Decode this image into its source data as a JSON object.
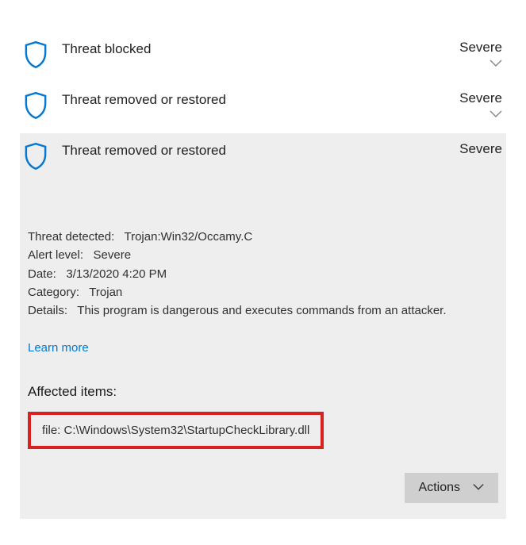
{
  "threats": [
    {
      "title": "Threat blocked",
      "severity": "Severe",
      "expanded": false
    },
    {
      "title": "Threat removed or restored",
      "severity": "Severe",
      "expanded": false
    },
    {
      "title": "Threat removed or restored",
      "severity": "Severe",
      "expanded": true,
      "details": {
        "threat_detected_label": "Threat detected:",
        "threat_detected_value": "Trojan:Win32/Occamy.C",
        "alert_level_label": "Alert level:",
        "alert_level_value": "Severe",
        "date_label": "Date:",
        "date_value": "3/13/2020 4:20 PM",
        "category_label": "Category:",
        "category_value": "Trojan",
        "details_label": "Details:",
        "details_value": "This program is dangerous and executes commands from an attacker."
      },
      "learn_more": "Learn more",
      "affected_heading": "Affected items:",
      "affected_item": "file: C:\\Windows\\System32\\StartupCheckLibrary.dll",
      "actions_label": "Actions"
    }
  ]
}
